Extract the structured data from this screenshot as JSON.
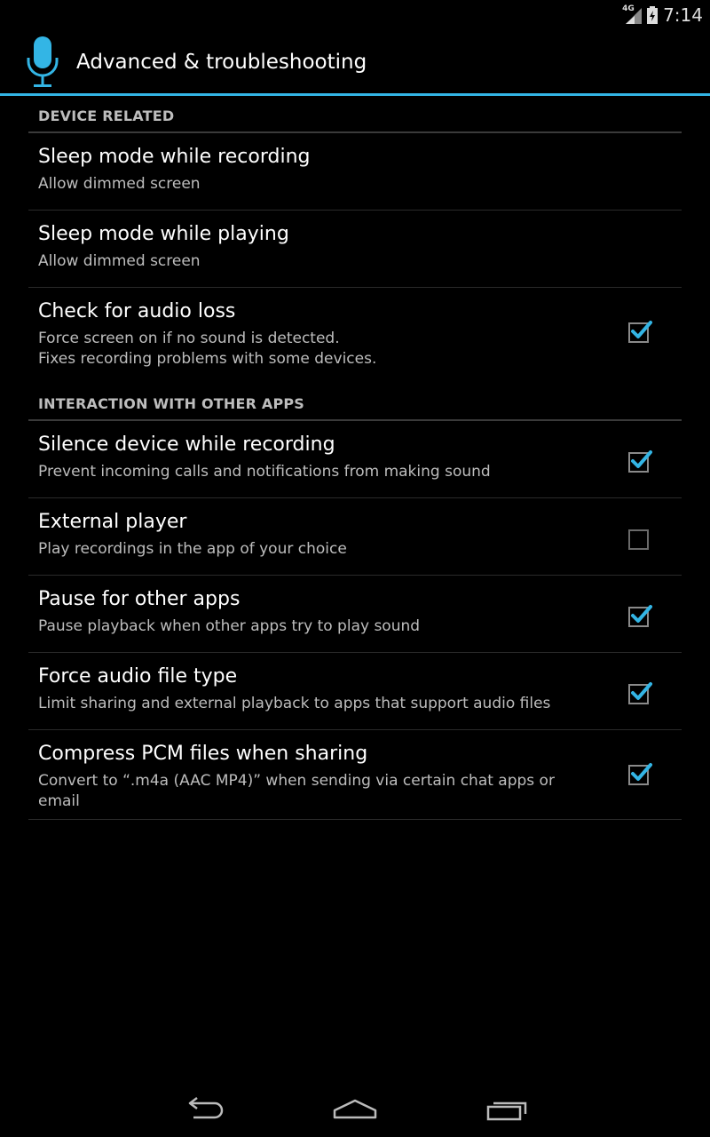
{
  "status_bar": {
    "time": "7:14",
    "network_label": "4G",
    "icons": [
      "signal-icon",
      "battery-icon"
    ]
  },
  "action_bar": {
    "icon": "microphone-icon",
    "title": "Advanced & troubleshooting",
    "accent_color": "#33b5e5"
  },
  "categories": [
    {
      "title": "DEVICE RELATED",
      "prefs": [
        {
          "title": "Sleep mode while recording",
          "summary": "Allow dimmed screen",
          "has_checkbox": false
        },
        {
          "title": "Sleep mode while playing",
          "summary": "Allow dimmed screen",
          "has_checkbox": false
        },
        {
          "title": "Check for audio loss",
          "summary": "Force screen on if no sound is detected.\nFixes recording problems with some devices.",
          "has_checkbox": true,
          "checked": true
        }
      ]
    },
    {
      "title": "INTERACTION WITH OTHER APPS",
      "prefs": [
        {
          "title": "Silence device while recording",
          "summary": "Prevent incoming calls and notifications from making sound",
          "has_checkbox": true,
          "checked": true
        },
        {
          "title": "External player",
          "summary": "Play recordings in the app of your choice",
          "has_checkbox": true,
          "checked": false
        },
        {
          "title": "Pause for other apps",
          "summary": "Pause playback when other apps try to play sound",
          "has_checkbox": true,
          "checked": true
        },
        {
          "title": "Force audio file type",
          "summary": "Limit sharing and external playback to apps that support audio files",
          "has_checkbox": true,
          "checked": true
        },
        {
          "title": "Compress PCM files when sharing",
          "summary": "Convert to “.m4a (AAC MP4)” when sending via certain chat apps or email",
          "has_checkbox": true,
          "checked": true
        }
      ]
    }
  ],
  "nav_bar": {
    "icons": [
      "back-icon",
      "home-icon",
      "recent-apps-icon"
    ]
  }
}
